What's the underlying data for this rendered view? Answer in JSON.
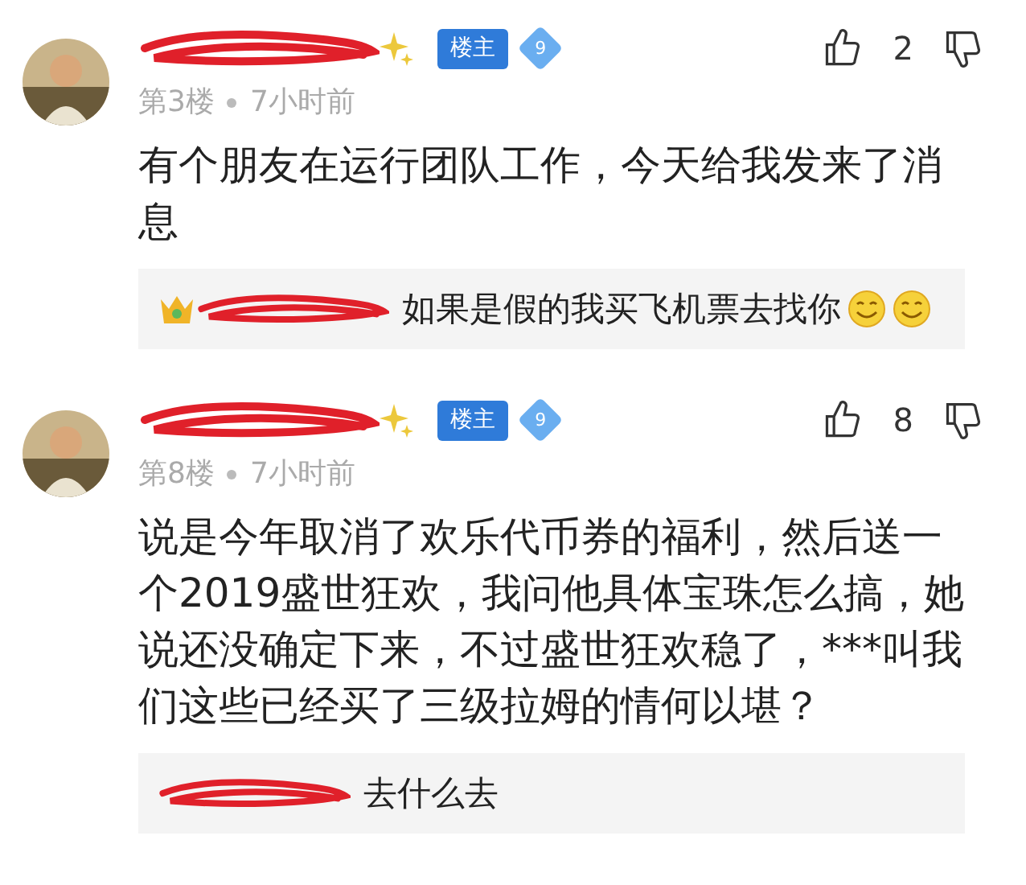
{
  "comments": [
    {
      "owner_badge": "楼主",
      "level_badge": "9",
      "floor": "第3楼",
      "time": "7小时前",
      "likes": "2",
      "text": "有个朋友在运行团队工作，今天给我发来了消息",
      "reply": {
        "crown": true,
        "text": "如果是假的我买飞机票去找你",
        "emojis": [
          {
            "kind": "smile"
          },
          {
            "kind": "smile"
          }
        ]
      }
    },
    {
      "owner_badge": "楼主",
      "level_badge": "9",
      "floor": "第8楼",
      "time": "7小时前",
      "likes": "8",
      "text": "说是今年取消了欢乐代币券的福利，然后送一个2019盛世狂欢，我问他具体宝珠怎么搞，她说还没确定下来，不过盛世狂欢稳了，***叫我们这些已经买了三级拉姆的情何以堪？",
      "reply": {
        "crown": false,
        "text": "去什么去"
      }
    }
  ]
}
